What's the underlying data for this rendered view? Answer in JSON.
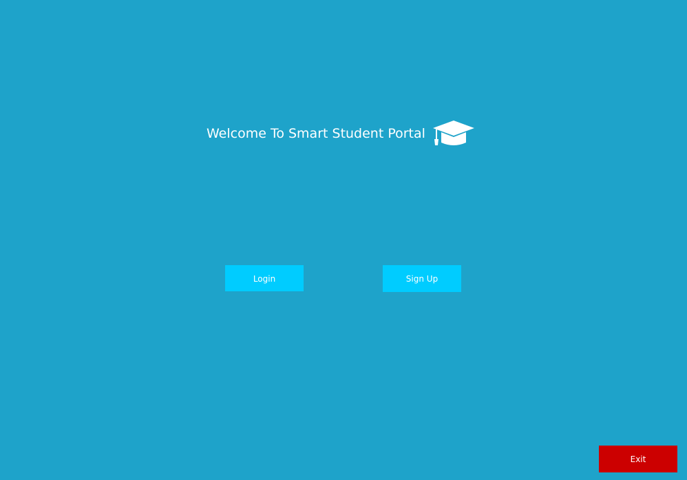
{
  "welcome": {
    "title": "Welcome To Smart Student Portal",
    "icon": "graduation-cap-icon"
  },
  "actions": {
    "login_label": "Login",
    "signup_label": "Sign Up",
    "exit_label": "Exit"
  },
  "colors": {
    "background": "#1EA3CA",
    "primary_button": "#00CCFF",
    "exit_button": "#CC0000",
    "text": "#FFFFFF"
  }
}
